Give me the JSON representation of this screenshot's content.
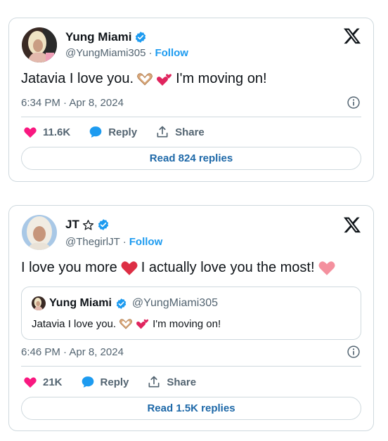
{
  "tweets": [
    {
      "author_name": "Yung Miami",
      "handle": "@YungMiami305",
      "follow_label": "Follow",
      "text_before": "Jatavia I love you.",
      "text_after": "I'm moving on!",
      "timestamp": "6:34 PM · Apr 8, 2024",
      "likes": "11.6K",
      "reply_label": "Reply",
      "share_label": "Share",
      "read_replies_label": "Read 824 replies"
    },
    {
      "author_name": "JT",
      "handle": "@ThegirlJT",
      "follow_label": "Follow",
      "text_before": "I love you more",
      "text_after": "I actually love you the most!",
      "timestamp": "6:46 PM · Apr 8, 2024",
      "likes": "21K",
      "reply_label": "Reply",
      "share_label": "Share",
      "read_replies_label": "Read 1.5K replies",
      "quoted_tweet": {
        "author_name": "Yung Miami",
        "handle": "@YungMiami305",
        "text_before": "Jatavia I love you.",
        "text_after": "I'm moving on!"
      }
    }
  ],
  "separator": "·",
  "colors": {
    "link_blue": "#1d9bf0",
    "verified_blue": "#1d9bf0",
    "like_pink": "#f91880",
    "secondary_text": "#536471",
    "border": "#cfd9de"
  },
  "icons": [
    "x-logo-icon",
    "verified-badge-icon",
    "heart-icon",
    "reply-bubble-icon",
    "share-icon",
    "info-icon",
    "star-outline-icon",
    "heart-hands-emoji",
    "two-hearts-emoji",
    "red-heart-emoji",
    "pink-heart-emoji"
  ]
}
